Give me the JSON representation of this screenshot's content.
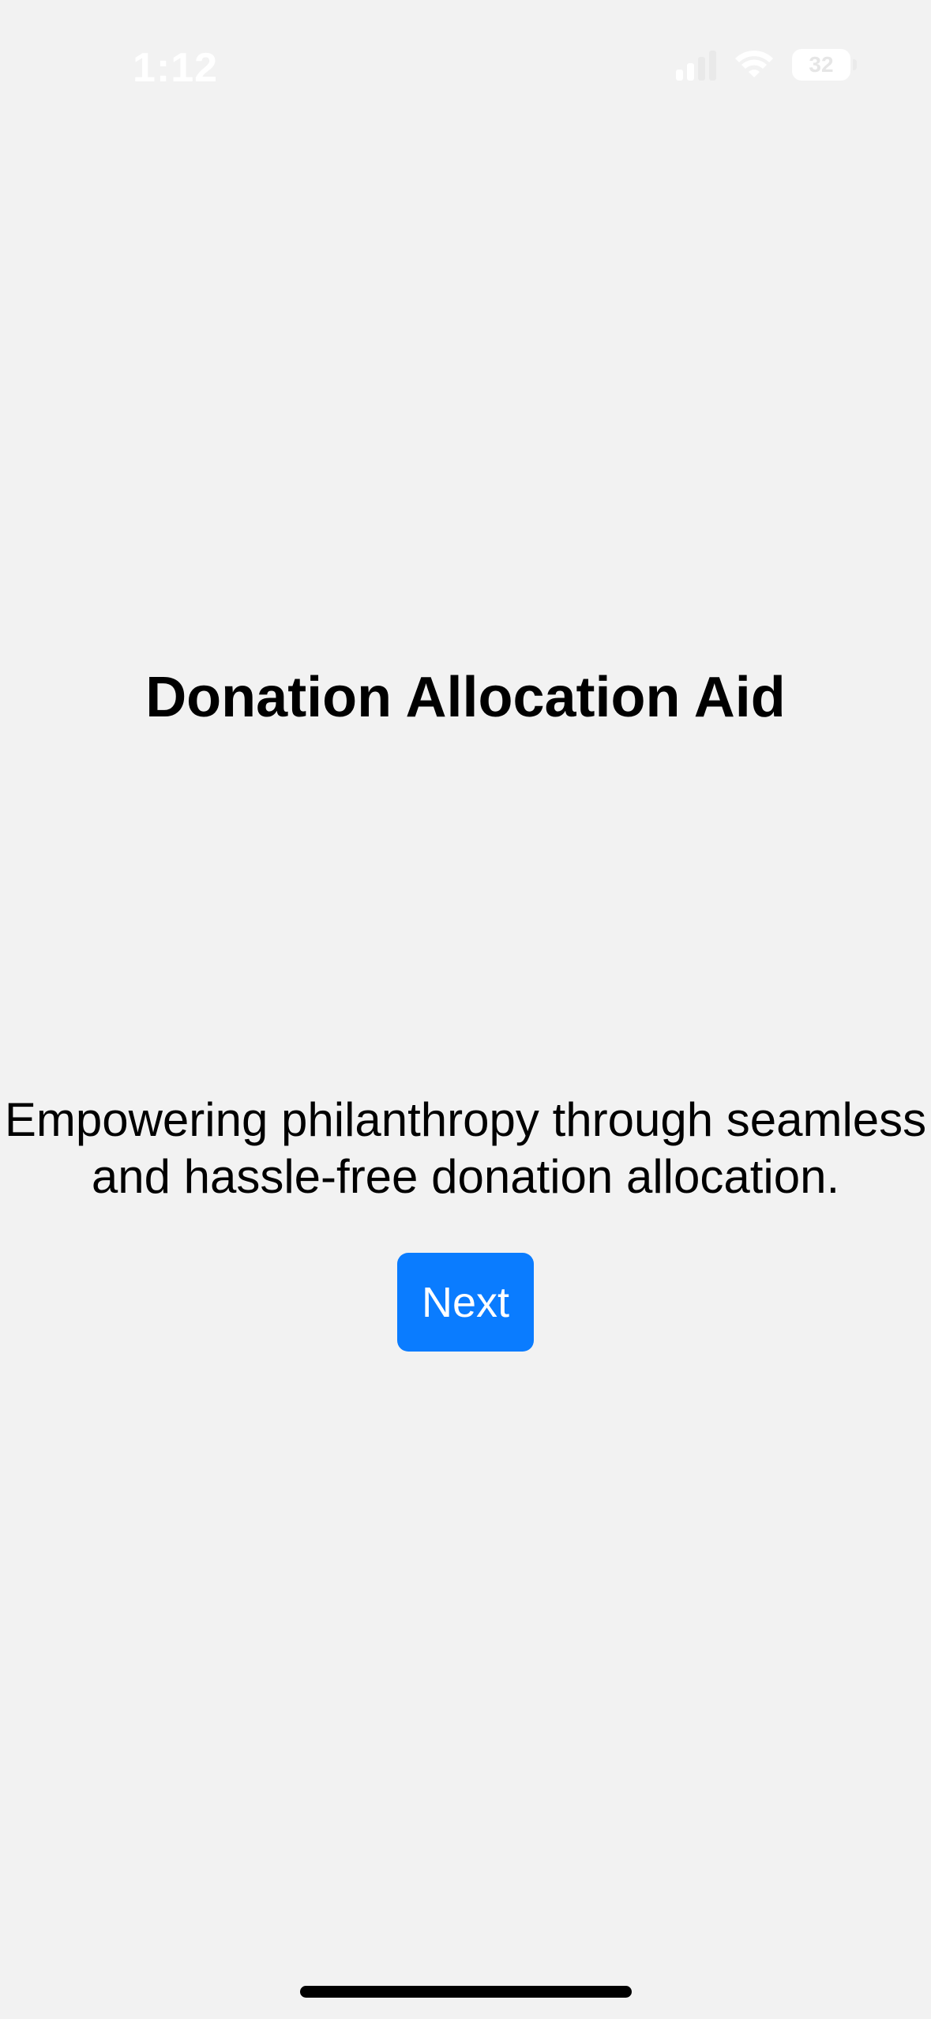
{
  "status_bar": {
    "time": "1:12",
    "battery_level": "32",
    "icons": [
      "cellular-signal-icon",
      "wifi-icon",
      "battery-icon"
    ]
  },
  "main": {
    "title": "Donation Allocation Aid",
    "tagline_line1": "Empowering philanthropy through seamless",
    "tagline_line2": "and hassle-free donation allocation.",
    "next_button_label": "Next"
  },
  "colors": {
    "background": "#f2f2f2",
    "accent": "#0a7cff",
    "text": "#000000"
  }
}
